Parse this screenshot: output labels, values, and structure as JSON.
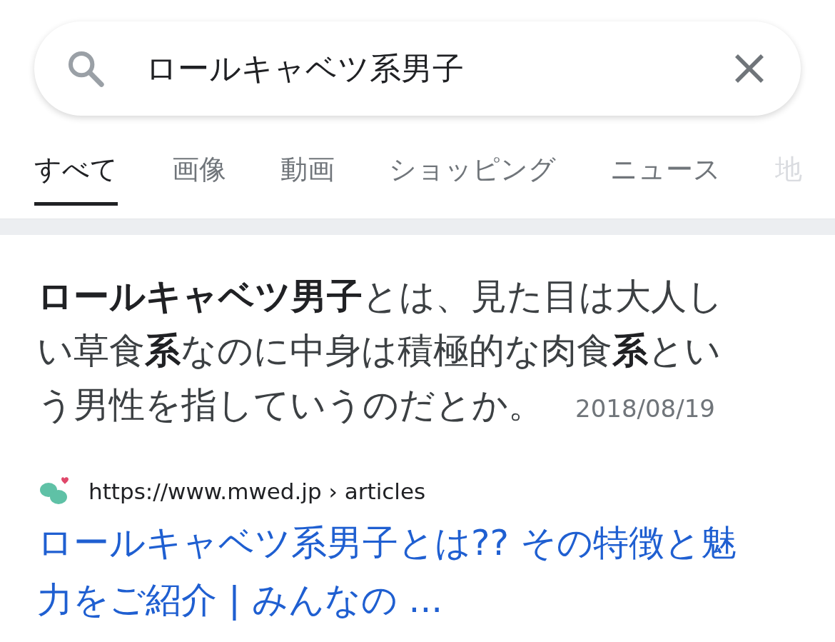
{
  "search": {
    "value": "ロールキャベツ系男子"
  },
  "tabs": [
    {
      "label": "すべて",
      "selected": true
    },
    {
      "label": "画像",
      "selected": false
    },
    {
      "label": "動画",
      "selected": false
    },
    {
      "label": "ショッピング",
      "selected": false
    },
    {
      "label": "ニュース",
      "selected": false
    },
    {
      "label": "地",
      "selected": false,
      "faded": true
    }
  ],
  "snippet": {
    "text": "**ロールキャベツ男子**とは、見た目は大人しい草食**系**なのに中身は積極的な肉食**系**という男性を指していうのだとか。",
    "date": "2018/08/19"
  },
  "result": {
    "url": "https://www.mwed.jp",
    "breadcrumb": "› articles",
    "title": "ロールキャベツ系男子とは?? その特徴と魅力をご紹介 | みんなの ..."
  }
}
